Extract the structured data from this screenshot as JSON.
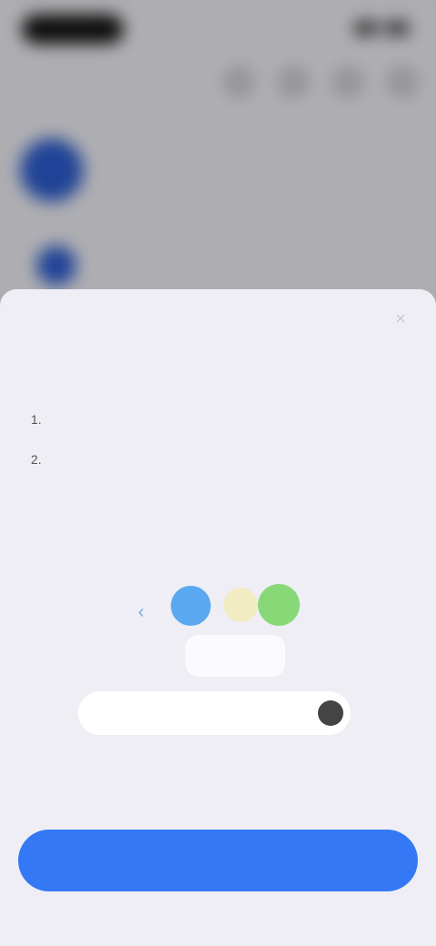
{
  "background_app": {
    "status_bar": {
      "time": ""
    },
    "header": {
      "title": ""
    },
    "rows": [
      {
        "text": ""
      },
      {
        "text": ""
      }
    ]
  },
  "sheet": {
    "close_label": "×",
    "title": "",
    "items": [
      {
        "num": "1.",
        "text": ""
      },
      {
        "num": "2.",
        "text": ""
      }
    ],
    "illustration": {
      "label": "",
      "small_text": "",
      "field_text": "",
      "note": ""
    },
    "primary_button": {
      "label": ""
    }
  },
  "colors": {
    "accent": "#3478f6",
    "avatar": "#2e5ed1",
    "sheet_bg": "#eeeef4",
    "dot_blue": "#5aa8f0",
    "dot_yellow": "#f1ecc2",
    "dot_green": "#89d877"
  },
  "icons": {
    "close": "close-icon",
    "header": [
      "add-icon",
      "filter-icon",
      "search-icon",
      "settings-icon"
    ]
  }
}
